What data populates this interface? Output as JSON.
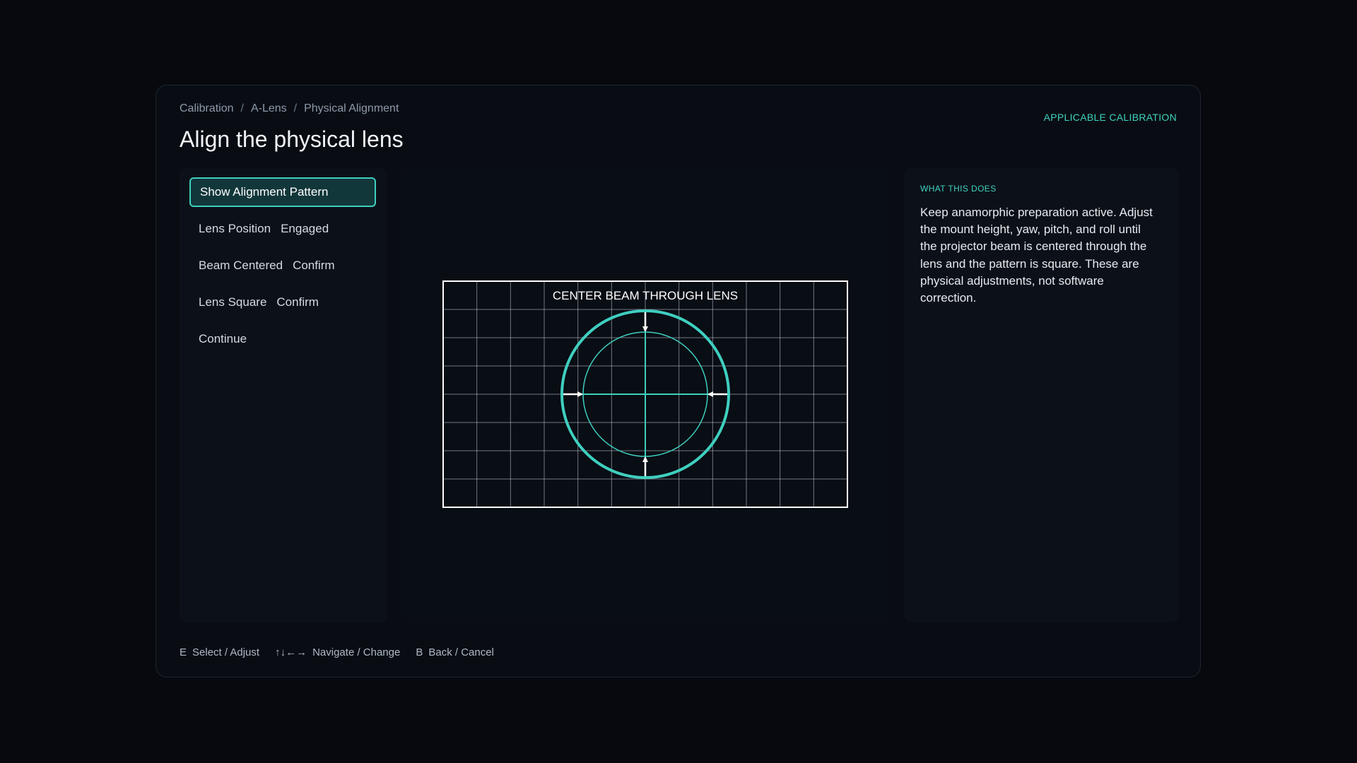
{
  "breadcrumb": [
    "Calibration",
    "A-Lens",
    "Physical Alignment"
  ],
  "page_title": "Align the physical lens",
  "applicable_label": "APPLICABLE CALIBRATION",
  "menu": {
    "items": [
      {
        "label": "Show Alignment Pattern",
        "value": "",
        "active": true
      },
      {
        "label": "Lens Position",
        "value": "Engaged",
        "active": false
      },
      {
        "label": "Beam Centered",
        "value": "Confirm",
        "active": false
      },
      {
        "label": "Lens Square",
        "value": "Confirm",
        "active": false
      },
      {
        "label": "Continue",
        "value": "",
        "active": false
      }
    ]
  },
  "pattern": {
    "caption": "CENTER BEAM THROUGH LENS",
    "accent_color": "#3fcfbf"
  },
  "info": {
    "heading": "WHAT THIS DOES",
    "body": "Keep anamorphic preparation active. Adjust the mount height, yaw, pitch, and roll until the projector beam is centered through the lens and the pattern is square. These are physical adjustments, not software correction."
  },
  "footer": {
    "hints": [
      {
        "key": "E",
        "label": "Select / Adjust"
      },
      {
        "key": "↑↓←→",
        "label": "Navigate / Change"
      },
      {
        "key": "B",
        "label": "Back / Cancel"
      }
    ]
  },
  "colors": {
    "accent": "#40d2bf",
    "background": "#07090e",
    "panel": "#090d13"
  }
}
